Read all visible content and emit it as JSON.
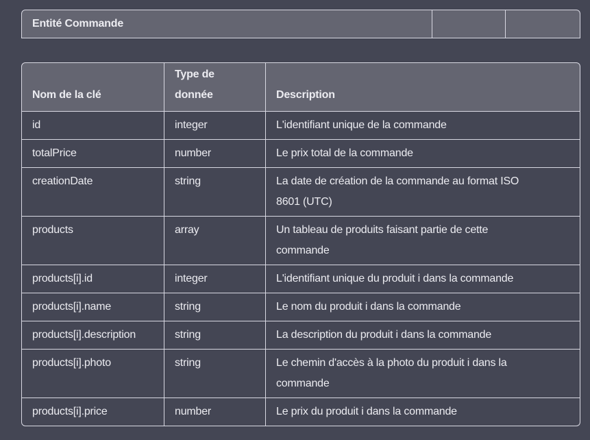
{
  "entity_table": {
    "title": "Entité Commande",
    "empty_cells": [
      "",
      ""
    ]
  },
  "fields_table": {
    "headers": {
      "key_name": "Nom de la clé",
      "data_type_line1": "Type de",
      "data_type_line2": "donnée",
      "description": "Description"
    },
    "rows": [
      {
        "key": "id",
        "type": "integer",
        "description": "L'identifiant unique de la commande"
      },
      {
        "key": "totalPrice",
        "type": "number",
        "description": "Le prix total de la commande"
      },
      {
        "key": "creationDate",
        "type": "string",
        "description_line1": "La date de création de la commande au format ISO",
        "description_line2": "8601 (UTC)"
      },
      {
        "key": "products",
        "type": "array",
        "description_line1": "Un tableau de produits faisant partie de cette",
        "description_line2": "commande"
      },
      {
        "key": "products[i].id",
        "type": "integer",
        "description": "L'identifiant unique du produit i dans la commande"
      },
      {
        "key": "products[i].name",
        "type": "string",
        "description": "Le nom du produit i dans la commande"
      },
      {
        "key": "products[i].description",
        "type": "string",
        "description": "La description du produit i dans la commande"
      },
      {
        "key": "products[i].photo",
        "type": "string",
        "description_line1": "Le chemin d'accès à la photo du produit i dans la",
        "description_line2": "commande"
      },
      {
        "key": "products[i].price",
        "type": "number",
        "description": "Le prix du produit i dans la commande"
      }
    ]
  }
}
